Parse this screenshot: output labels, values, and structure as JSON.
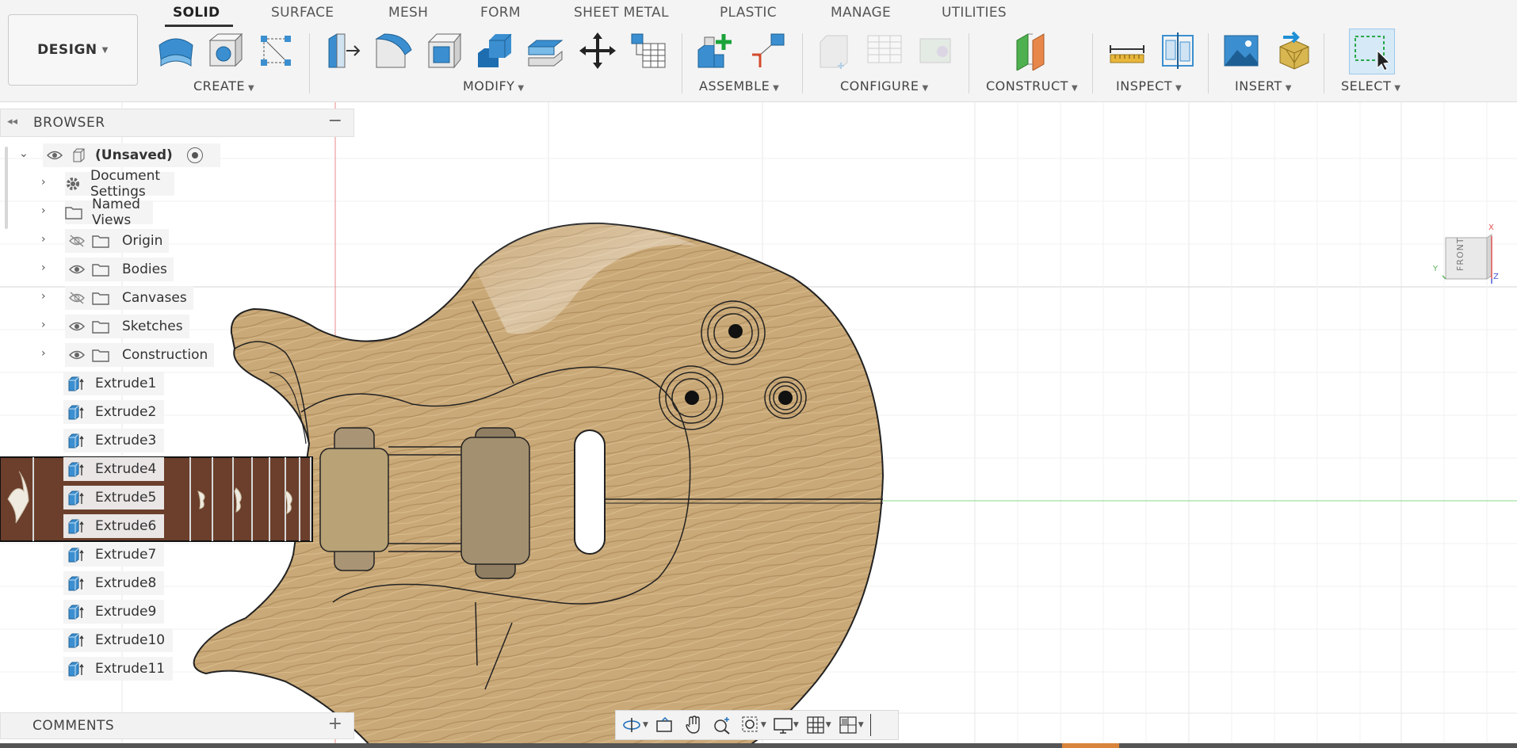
{
  "workspace": {
    "label": "DESIGN"
  },
  "tabs": [
    {
      "label": "SOLID",
      "active": true
    },
    {
      "label": "SURFACE"
    },
    {
      "label": "MESH"
    },
    {
      "label": "FORM"
    },
    {
      "label": "SHEET METAL"
    },
    {
      "label": "PLASTIC"
    },
    {
      "label": "MANAGE"
    },
    {
      "label": "UTILITIES"
    }
  ],
  "groups": {
    "create": "CREATE",
    "modify": "MODIFY",
    "assemble": "ASSEMBLE",
    "configure": "CONFIGURE",
    "construct": "CONSTRUCT",
    "inspect": "INSPECT",
    "insert": "INSERT",
    "select": "SELECT"
  },
  "browser": {
    "title": "BROWSER",
    "root": "(Unsaved)",
    "items": [
      {
        "label": "Document Settings",
        "icon": "gear-icon"
      },
      {
        "label": "Named Views",
        "icon": "folder-icon"
      },
      {
        "label": "Origin",
        "visibility": "hidden"
      },
      {
        "label": "Bodies",
        "visibility": "visible"
      },
      {
        "label": "Canvases",
        "visibility": "hidden"
      },
      {
        "label": "Sketches",
        "visibility": "visible"
      },
      {
        "label": "Construction",
        "visibility": "visible"
      }
    ],
    "features": [
      "Extrude1",
      "Extrude2",
      "Extrude3",
      "Extrude4",
      "Extrude5",
      "Extrude6",
      "Extrude7",
      "Extrude8",
      "Extrude9",
      "Extrude10",
      "Extrude11"
    ]
  },
  "comments": {
    "title": "COMMENTS"
  },
  "viewcube": {
    "face": "FRONT",
    "axes": {
      "x": "X",
      "y": "Y",
      "z": "Z"
    }
  },
  "colors": {
    "accent": "#1f8fd6",
    "wood": "#c9ab7a",
    "fretboard": "#6b3f2c"
  }
}
